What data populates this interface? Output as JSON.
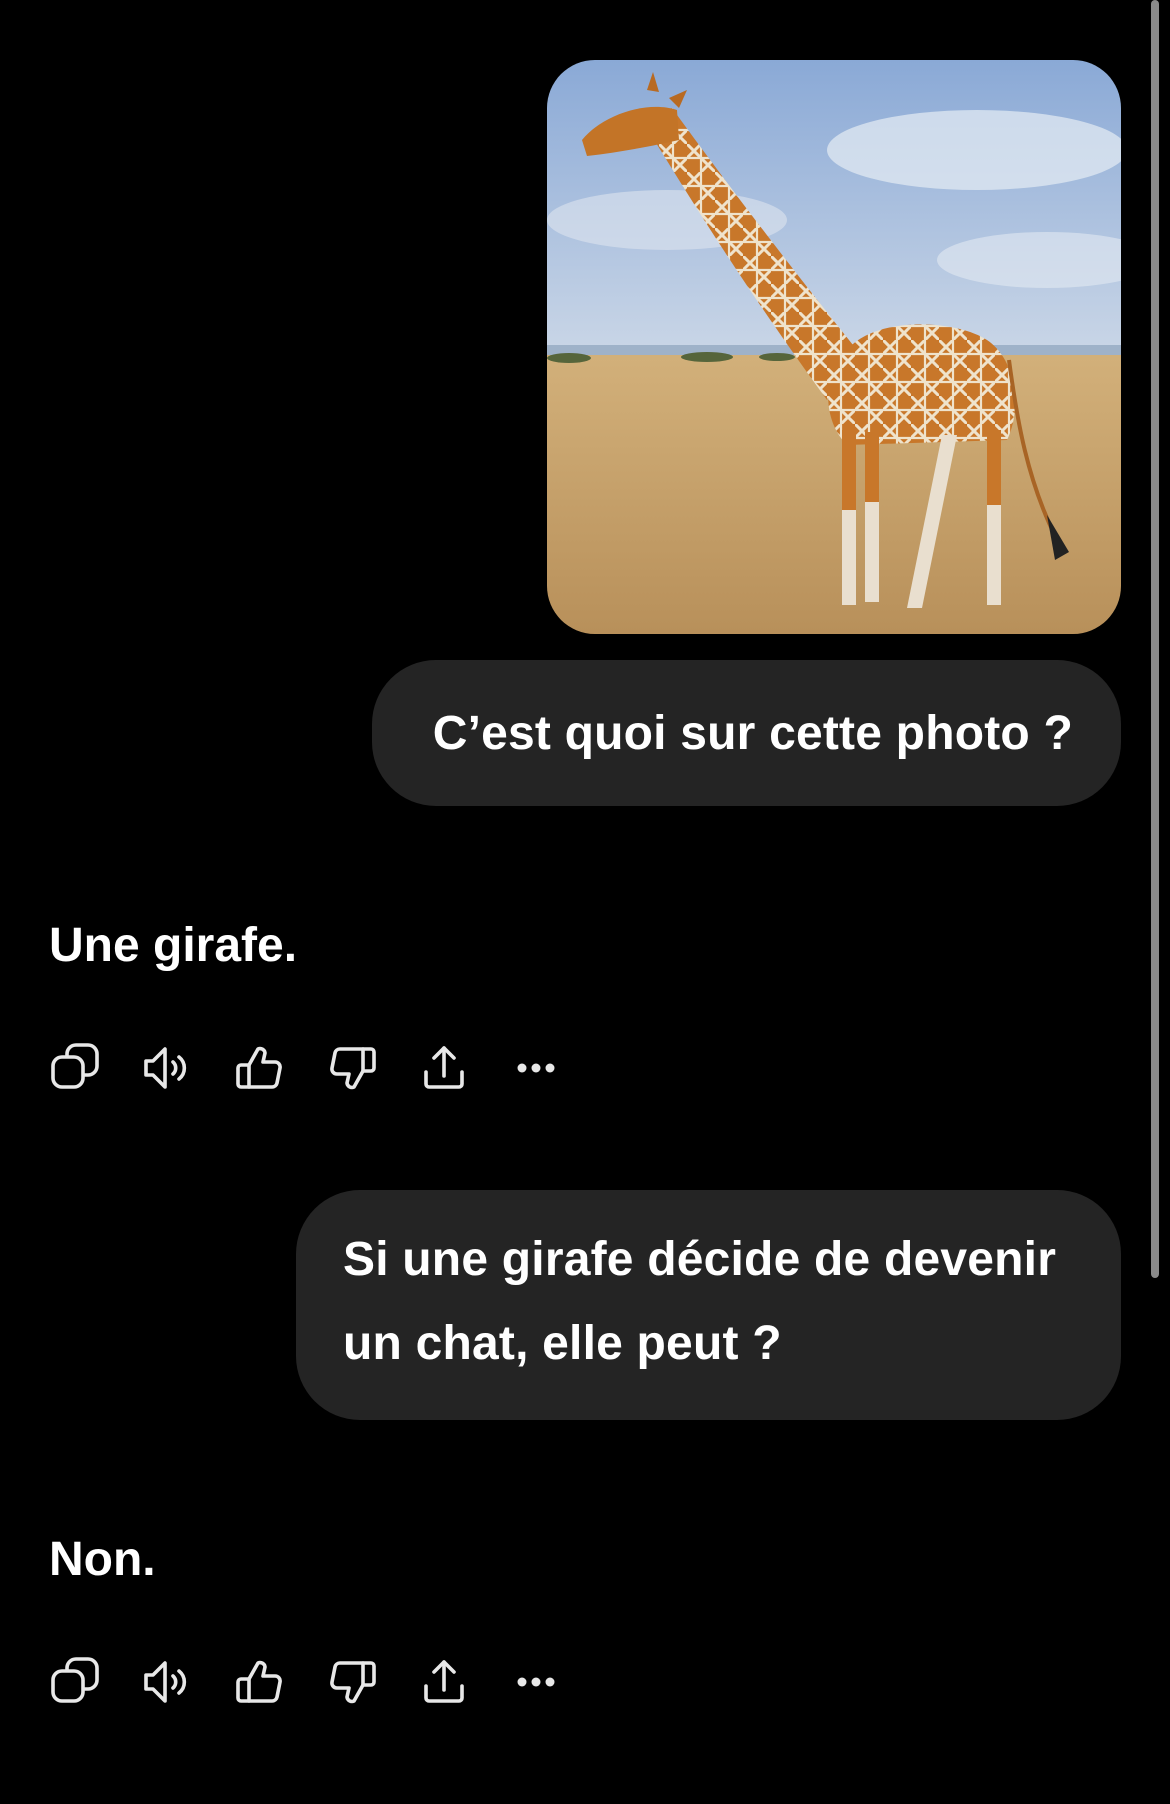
{
  "conversation": {
    "image": {
      "subject": "giraffe",
      "colors": {
        "sky_top": "#8faedb",
        "sky_bottom": "#c9d6e8",
        "grass": "#c9a46b",
        "giraffe": "#c8772a",
        "pattern_lines": "#efe3cc"
      }
    },
    "user_message_1": "C’est quoi sur cette photo ?",
    "assistant_reply_1": "Une girafe.",
    "user_message_2_line_1": "Si une girafe décide de devenir",
    "user_message_2_line_2": "un chat, elle peut ?",
    "assistant_reply_2": "Non."
  },
  "action_bar": {
    "icons": [
      "copy-icon",
      "speaker-icon",
      "thumbs-up-icon",
      "thumbs-down-icon",
      "share-icon",
      "more-icon"
    ]
  },
  "theme": {
    "background": "#000000",
    "bubble": "#242424",
    "text": "#ffffff",
    "icon": "#e8e8e8"
  }
}
